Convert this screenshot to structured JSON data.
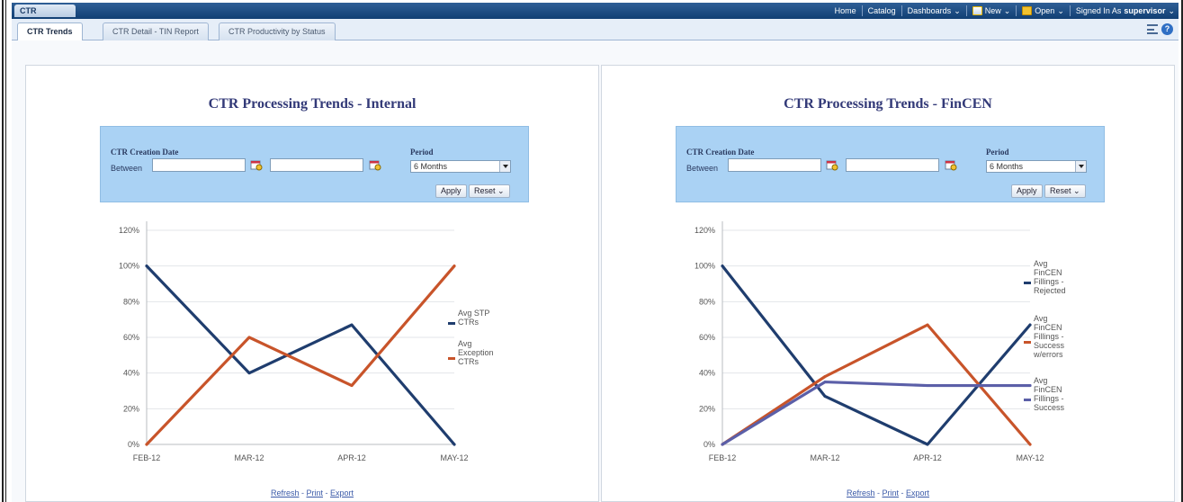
{
  "app": {
    "title": "CTR"
  },
  "topnav": {
    "home": "Home",
    "catalog": "Catalog",
    "dashboards": "Dashboards",
    "new": "New",
    "open": "Open",
    "signed_in_as": "Signed In As",
    "user": "supervisor"
  },
  "tabs": [
    {
      "label": "CTR Trends",
      "active": true
    },
    {
      "label": "CTR Detail - TIN Report",
      "active": false
    },
    {
      "label": "CTR Productivity by Status",
      "active": false
    }
  ],
  "colors": {
    "navy": "#1f3d6e",
    "orange": "#c8542a",
    "purple": "#5b5fa8",
    "title": "#333a78",
    "prompt_bg": "#aad2f4"
  },
  "panels": [
    {
      "title": "CTR Processing Trends - Internal",
      "prompt": {
        "date_label": "CTR Creation Date",
        "between_label": "Between",
        "period_label": "Period",
        "period_value": "6 Months",
        "apply": "Apply",
        "reset": "Reset"
      },
      "links": {
        "refresh": "Refresh",
        "print": "Print",
        "export": "Export"
      },
      "chart_data": {
        "type": "line",
        "categories": [
          "FEB-12",
          "MAR-12",
          "APR-12",
          "MAY-12"
        ],
        "y_ticks": [
          "0%",
          "20%",
          "40%",
          "60%",
          "80%",
          "100%",
          "120%"
        ],
        "ylim": [
          0,
          120
        ],
        "series": [
          {
            "name": "Avg STP CTRs",
            "legend_lines": [
              "Avg STP",
              "CTRs"
            ],
            "values": [
              100,
              40,
              67,
              0
            ],
            "color": "#1f3d6e"
          },
          {
            "name": "Avg Exception CTRs",
            "legend_lines": [
              "Avg",
              "Exception",
              "CTRs"
            ],
            "values": [
              0,
              60,
              33,
              100
            ],
            "color": "#c8542a"
          }
        ]
      }
    },
    {
      "title": "CTR Processing Trends - FinCEN",
      "prompt": {
        "date_label": "CTR Creation Date",
        "between_label": "Between",
        "period_label": "Period",
        "period_value": "6 Months",
        "apply": "Apply",
        "reset": "Reset"
      },
      "links": {
        "refresh": "Refresh",
        "print": "Print",
        "export": "Export"
      },
      "chart_data": {
        "type": "line",
        "categories": [
          "FEB-12",
          "MAR-12",
          "APR-12",
          "MAY-12"
        ],
        "y_ticks": [
          "0%",
          "20%",
          "40%",
          "60%",
          "80%",
          "100%",
          "120%"
        ],
        "ylim": [
          0,
          120
        ],
        "series": [
          {
            "name": "Avg FinCEN Fillings - Rejected",
            "legend_lines": [
              "Avg",
              "FinCEN",
              "Fillings -",
              "Rejected"
            ],
            "values": [
              100,
              27,
              0,
              67
            ],
            "color": "#1f3d6e"
          },
          {
            "name": "Avg FinCEN Fillings - Success w/errors",
            "legend_lines": [
              "Avg",
              "FinCEN",
              "Fillings -",
              "Success",
              "w/errors"
            ],
            "values": [
              0,
              38,
              67,
              0
            ],
            "color": "#c8542a"
          },
          {
            "name": "Avg FinCEN Fillings - Success",
            "legend_lines": [
              "Avg",
              "FinCEN",
              "Fillings -",
              "Success"
            ],
            "values": [
              0,
              35,
              33,
              33
            ],
            "color": "#5b5fa8"
          }
        ]
      }
    }
  ]
}
